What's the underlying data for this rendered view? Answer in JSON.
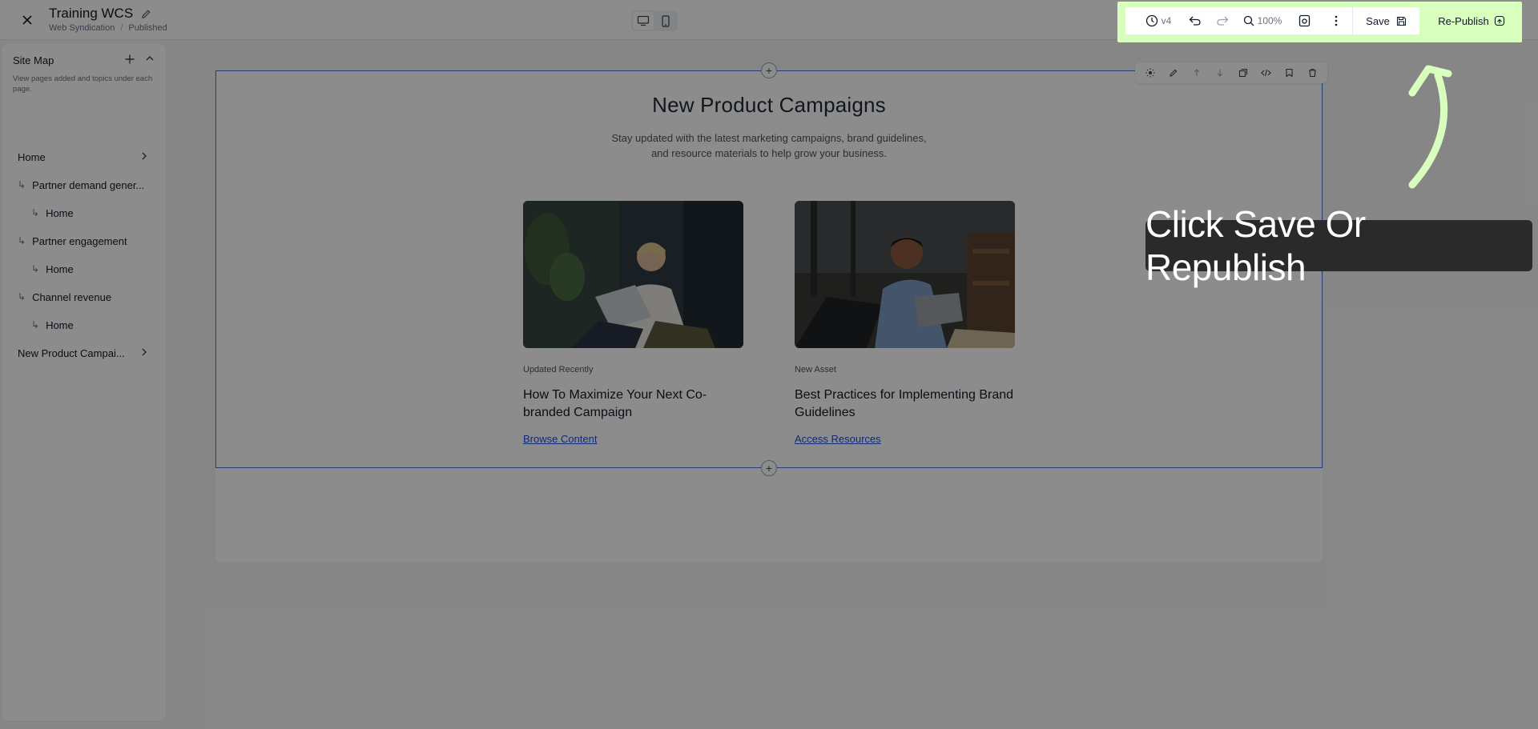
{
  "header": {
    "title": "Training WCS",
    "breadcrumb": [
      "Web Syndication",
      "Published"
    ],
    "breadcrumb_sep": "/"
  },
  "toolbar": {
    "version": "v4",
    "zoom": "100%",
    "save_label": "Save",
    "republish_label": "Re-Publish",
    "highlight_color": "#d9ffbf"
  },
  "sidebar": {
    "title": "Site Map",
    "description": "View pages added and topics under each page.",
    "items": [
      {
        "label": "Home",
        "level": 0,
        "chevron": true
      },
      {
        "label": "Partner demand gener...",
        "level": 1,
        "chevron": false
      },
      {
        "label": "Home",
        "level": 2,
        "chevron": false
      },
      {
        "label": "Partner engagement",
        "level": 1,
        "chevron": false
      },
      {
        "label": "Home",
        "level": 2,
        "chevron": false
      },
      {
        "label": "Channel revenue",
        "level": 1,
        "chevron": false
      },
      {
        "label": "Home",
        "level": 2,
        "chevron": false
      },
      {
        "label": "New Product Campai...",
        "level": 0,
        "chevron": true
      }
    ]
  },
  "main": {
    "section_title": "New Product Campaigns",
    "section_description": "Stay updated with the latest marketing campaigns, brand guidelines, and resource materials to help grow your business.",
    "cards": [
      {
        "eyebrow": "Updated Recently",
        "title": "How To Maximize Your Next Co-branded Campaign",
        "link": "Browse Content"
      },
      {
        "eyebrow": "New Asset",
        "title": "Best Practices for Implementing Brand Guidelines",
        "link": "Access Resources"
      }
    ]
  },
  "annotation": {
    "callout_text": "Click Save Or Republish",
    "arrow_color": "#d9ffbf"
  }
}
